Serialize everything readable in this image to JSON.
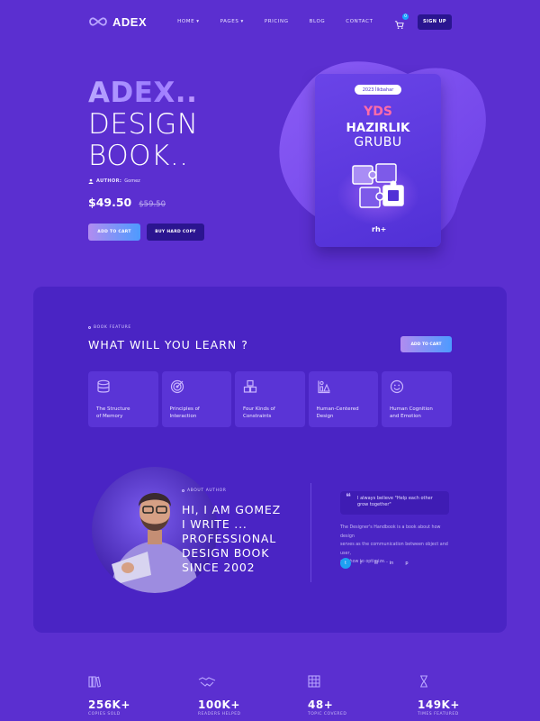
{
  "nav": {
    "brand": "ADEX",
    "items": [
      {
        "label": "HOME",
        "caret": "▾"
      },
      {
        "label": "PAGES",
        "caret": "▾"
      },
      {
        "label": "PRICING",
        "caret": ""
      },
      {
        "label": "BLOG",
        "caret": ""
      },
      {
        "label": "CONTACT",
        "caret": ""
      }
    ],
    "cart_count": "0",
    "signup": "SIGN UP"
  },
  "hero": {
    "title_line1": "ADEX..",
    "title_line2": "DESIGN",
    "title_line3": "BOOK..",
    "author_label": "AUTHOR:",
    "author_name": "Gomez",
    "price": "$49.50",
    "old_price": "$59.50",
    "add_to_cart": "ADD TO CART",
    "buy_hard_copy": "BUY HARD COPY"
  },
  "book": {
    "pill": "2023 İlkbahar",
    "line1": "YDS",
    "line2": "HAZIRLIK",
    "line3": "GRUBU",
    "logo": "rh+"
  },
  "features": {
    "eyebrow": "BOOK FEATURE",
    "title": "WHAT WILL YOU LEARN ?",
    "cart_button": "ADD TO CART",
    "cards": [
      {
        "l1": "The Structure",
        "l2": "of Memory",
        "icon": "database-icon"
      },
      {
        "l1": "Principles of",
        "l2": "Interaction",
        "icon": "target-icon"
      },
      {
        "l1": "Four Kinds of",
        "l2": "Constraints",
        "icon": "cubes-icon"
      },
      {
        "l1": "Human-Centered",
        "l2": "Design",
        "icon": "chart-icon"
      },
      {
        "l1": "Human Cognition",
        "l2": "and Emotion",
        "icon": "smile-icon"
      }
    ]
  },
  "about": {
    "eyebrow": "ABOUT AUTHOR",
    "line1": "HI, I AM GOMEZ",
    "line2": "I WRITE  ...",
    "line3": "PROFESSIONAL",
    "line4": "DESIGN BOOK",
    "line5": "SINCE 2002",
    "quote1": "I always believe \"Help each other",
    "quote2": "grow together\"",
    "text1": "The Designer's Handbook is a book about how design",
    "text2": "serves as the communication between object and user,",
    "text3": "and how to optimize...",
    "socials": [
      "t",
      "f",
      "✉",
      "in",
      "p"
    ]
  },
  "stats": [
    {
      "value": "256K+",
      "caption": "COPIES SOLD",
      "icon": "books-icon"
    },
    {
      "value": "100K+",
      "caption": "READERS HELPED",
      "icon": "handshake-icon"
    },
    {
      "value": "48+",
      "caption": "TOPIC COVERED",
      "icon": "grid-icon"
    },
    {
      "value": "149K+",
      "caption": "TIMES FEATURED",
      "icon": "hourglass-icon"
    }
  ],
  "colors": {
    "background": "#5b2fd0",
    "panel": "#4a24c4",
    "accent_pink": "#ff6ca8",
    "accent_blue": "#1ea1f2"
  }
}
